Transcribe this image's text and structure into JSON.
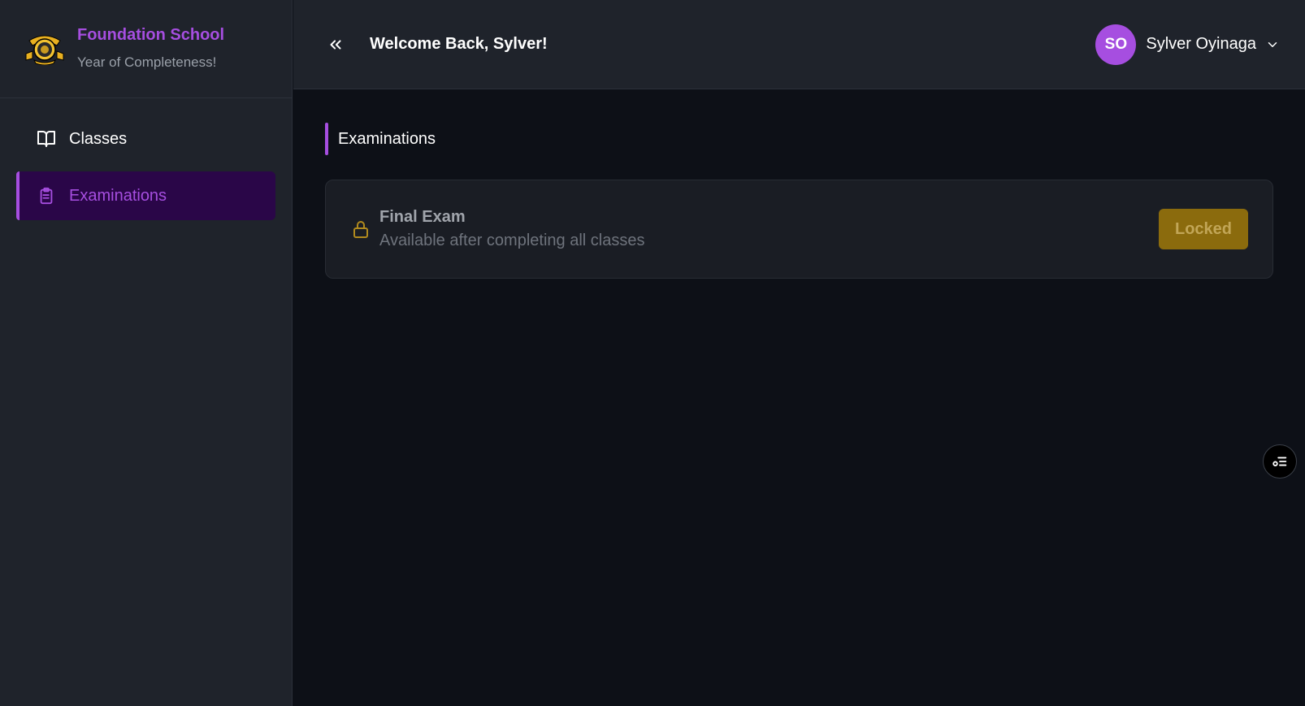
{
  "brand": {
    "title": "Foundation School",
    "subtitle": "Year of Completeness!",
    "logo": "school-crest-logo"
  },
  "sidebar": {
    "items": [
      {
        "label": "Classes",
        "icon": "book-open-icon",
        "active": false
      },
      {
        "label": "Examinations",
        "icon": "clipboard-list-icon",
        "active": true
      }
    ]
  },
  "header": {
    "collapse_icon": "chevrons-left-icon",
    "welcome": "Welcome Back, Sylver!",
    "user": {
      "initials": "SO",
      "name": "Sylver Oyinaga"
    }
  },
  "main": {
    "section_title": "Examinations",
    "exams": [
      {
        "title": "Final Exam",
        "subtitle": "Available after completing all classes",
        "status": "Locked",
        "icon": "lock-icon"
      }
    ]
  },
  "colors": {
    "accent": "#a64ee0",
    "active_bg": "#2a0648",
    "locked": "#8b6b0d",
    "panel": "#1f232b",
    "background": "#0d1017"
  }
}
